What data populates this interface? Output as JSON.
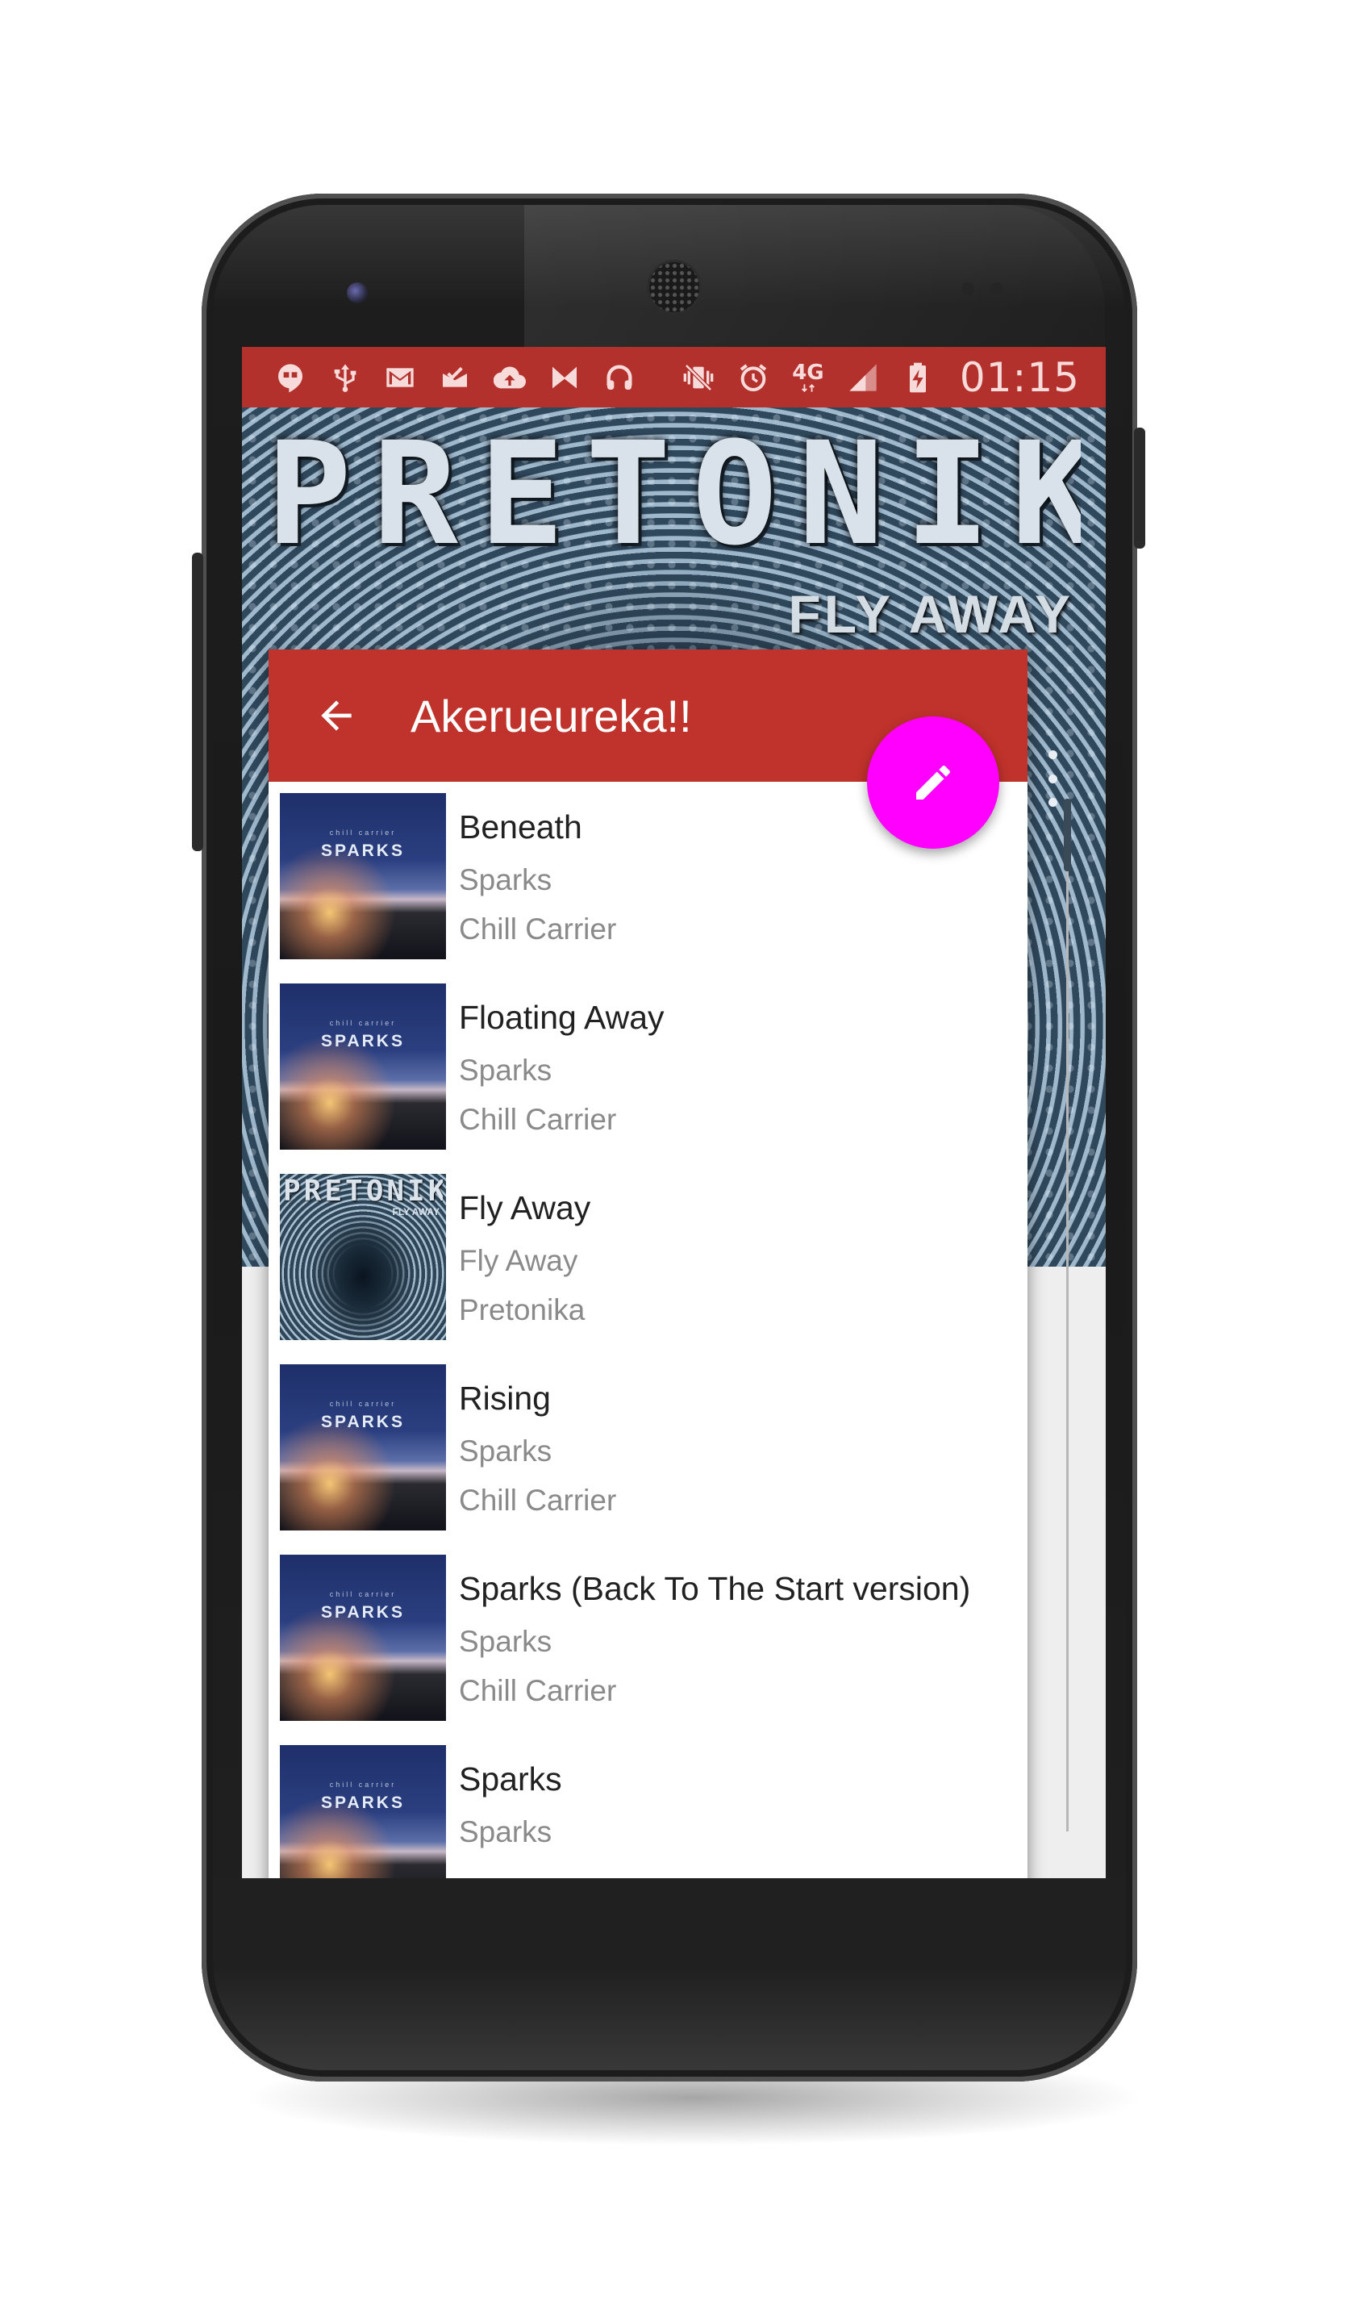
{
  "status_bar": {
    "network": "4G",
    "time": "01:15",
    "left_icons": [
      "hangouts-icon",
      "usb-icon",
      "gmail-icon",
      "inbox-icon",
      "cloud-upload-icon",
      "mail-m-icon",
      "headphones-icon"
    ],
    "right_icons": [
      "vibrate-icon",
      "alarm-icon",
      "network-4g-icon",
      "signal-icon",
      "battery-charging-icon"
    ],
    "color": "#b3312c"
  },
  "hero": {
    "album_art_title": "PRETONIKA",
    "album_art_subtitle": "FLY AWAY"
  },
  "dialog": {
    "title": "Akerueureka!!",
    "toolbar_color": "#c0322c",
    "fab_icon": "pencil-icon",
    "fab_color": "#ff00ff",
    "back_icon": "arrow-back-icon"
  },
  "tracks": [
    {
      "title": "Beneath",
      "album": "Sparks",
      "artist": "Chill Carrier",
      "art": "sparks",
      "art_text": "SPARKS",
      "art_small": "chill carrier"
    },
    {
      "title": "Floating Away",
      "album": "Sparks",
      "artist": "Chill Carrier",
      "art": "sparks",
      "art_text": "SPARKS",
      "art_small": "chill carrier"
    },
    {
      "title": "Fly Away",
      "album": "Fly Away",
      "artist": "Pretonika",
      "art": "pretonika",
      "art_text": "PRETONIKA",
      "art_small": "FLY AWAY"
    },
    {
      "title": "Rising",
      "album": "Sparks",
      "artist": "Chill Carrier",
      "art": "sparks",
      "art_text": "SPARKS",
      "art_small": "chill carrier"
    },
    {
      "title": "Sparks (Back To The Start version)",
      "album": "Sparks",
      "artist": "Chill Carrier",
      "art": "sparks",
      "art_text": "SPARKS",
      "art_small": "chill carrier"
    },
    {
      "title": "Sparks",
      "album": "Sparks",
      "artist": "",
      "art": "sparks",
      "art_text": "SPARKS",
      "art_small": "chill carrier"
    }
  ]
}
